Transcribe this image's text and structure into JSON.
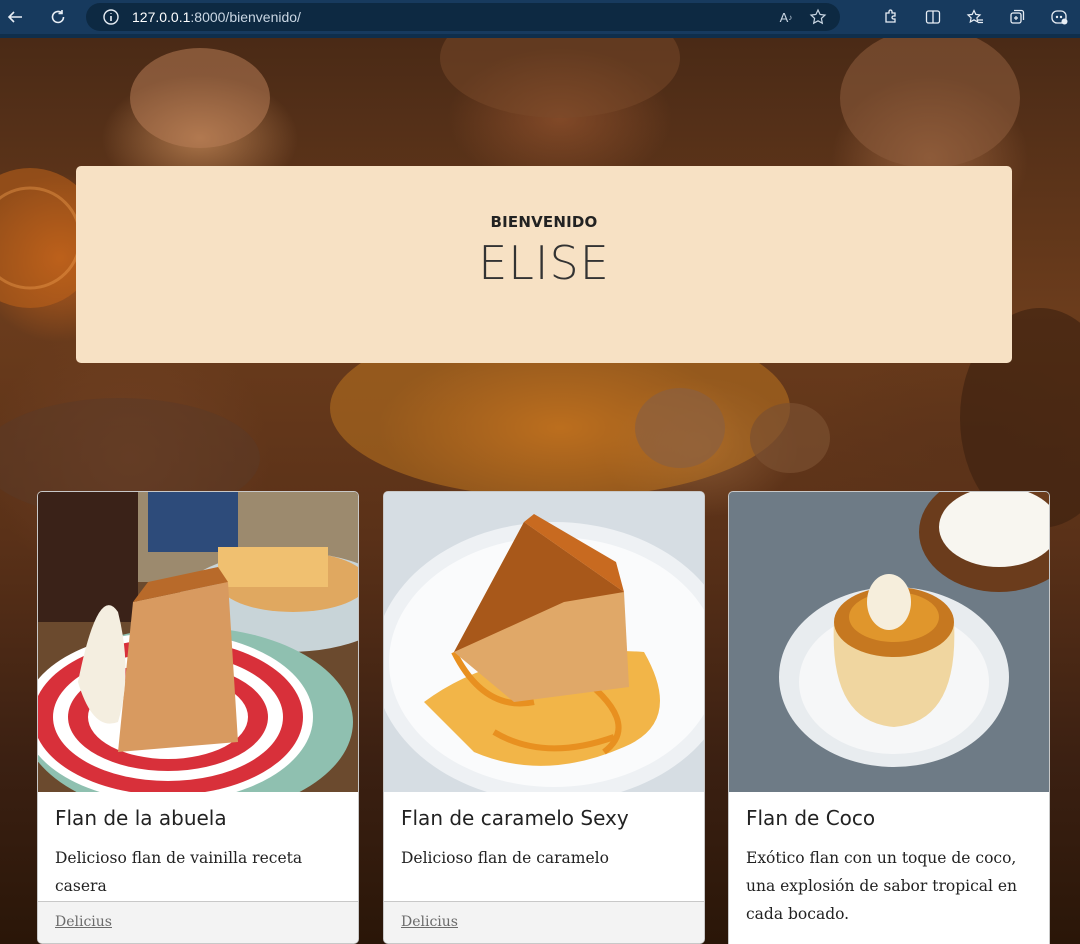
{
  "browser": {
    "url_host": "127.0.0.1",
    "url_rest": ":8000/bienvenido/"
  },
  "welcome": {
    "label": "BIENVENIDO",
    "name": "ELISE"
  },
  "cards": [
    {
      "title": "Flan de la abuela",
      "text": "Delicioso flan de vainilla receta casera",
      "link": "Delicius"
    },
    {
      "title": "Flan de caramelo Sexy",
      "text": "Delicioso flan de caramelo",
      "link": "Delicius"
    },
    {
      "title": "Flan de Coco",
      "text": "Exótico flan con un toque de coco, una explosión de sabor tropical en cada bocado."
    }
  ],
  "colors": {
    "browser_bar": "#173a5e",
    "welcome_panel": "#f7e1c4",
    "caramel": "#d98a1c"
  },
  "icons": [
    "back-icon",
    "reload-icon",
    "info-icon",
    "read-aloud-icon",
    "favorite-star-icon",
    "extensions-icon",
    "split-screen-icon",
    "favorites-icon",
    "collections-icon",
    "copilot-icon"
  ]
}
